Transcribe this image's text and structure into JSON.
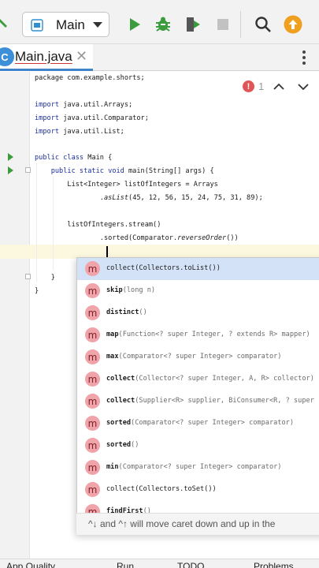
{
  "toolbar": {
    "run_config_label": "Main",
    "icons": [
      "hammer-icon",
      "java-class-icon",
      "run-icon",
      "debug-icon",
      "coverage-icon",
      "stop-icon",
      "search-icon",
      "update-icon"
    ],
    "colors": {
      "run": "#3c9b3c",
      "debug": "#3c9b3c",
      "update": "#f0a020"
    }
  },
  "tab": {
    "icon_letter": "C",
    "label": "Main.java",
    "close": "✕"
  },
  "inspection": {
    "count": "1"
  },
  "code": [
    {
      "parts": [
        {
          "t": "package com.example.shorts;",
          "c": ""
        }
      ]
    },
    {
      "parts": [
        {
          "t": "import",
          "c": "kw"
        },
        {
          "t": " java.util.Arrays;",
          "c": ""
        }
      ]
    },
    {
      "parts": [
        {
          "t": "import",
          "c": "kw"
        },
        {
          "t": " java.util.Comparator;",
          "c": ""
        }
      ]
    },
    {
      "parts": [
        {
          "t": "import",
          "c": "kw"
        },
        {
          "t": " java.util.List;",
          "c": ""
        }
      ]
    },
    {
      "parts": [
        {
          "t": "public class",
          "c": "kw"
        },
        {
          "t": " Main {",
          "c": ""
        }
      ]
    },
    {
      "parts": [
        {
          "t": "    public static void",
          "c": "kw"
        },
        {
          "t": " main(String[] args) {",
          "c": ""
        }
      ]
    },
    {
      "parts": [
        {
          "t": "        List<Integer> listOfIntegers = Arrays",
          "c": ""
        }
      ]
    },
    {
      "parts": [
        {
          "t": "                .",
          "c": ""
        },
        {
          "t": "asList",
          "c": "it"
        },
        {
          "t": "(45, 12, 56, 15, 24, 75, 31, 89);",
          "c": ""
        }
      ]
    },
    {
      "parts": [
        {
          "t": "        listOfIntegers.stream()",
          "c": ""
        }
      ]
    },
    {
      "parts": [
        {
          "t": "                .sorted(Comparator.",
          "c": ""
        },
        {
          "t": "reverseOrder",
          "c": "it"
        },
        {
          "t": "())",
          "c": ""
        }
      ]
    },
    {
      "parts": [
        {
          "t": "    }",
          "c": ""
        }
      ]
    },
    {
      "parts": [
        {
          "t": "}",
          "c": ""
        }
      ]
    }
  ],
  "completion": {
    "items": [
      {
        "name": "collect(Collectors.toList())",
        "params": "",
        "bold": false
      },
      {
        "name": "skip",
        "params": "(long n)",
        "bold": true
      },
      {
        "name": "distinct",
        "params": "()",
        "bold": true
      },
      {
        "name": "map",
        "params": "(Function<? super Integer, ? extends R> mapper)",
        "bold": true
      },
      {
        "name": "max",
        "params": "(Comparator<? super Integer> comparator)",
        "bold": true
      },
      {
        "name": "collect",
        "params": "(Collector<? super Integer, A, R> collector)",
        "bold": true
      },
      {
        "name": "collect",
        "params": "(Supplier<R> supplier, BiConsumer<R, ? super",
        "bold": true
      },
      {
        "name": "sorted",
        "params": "(Comparator<? super Integer> comparator)",
        "bold": true
      },
      {
        "name": "sorted",
        "params": "()",
        "bold": true
      },
      {
        "name": "min",
        "params": "(Comparator<? super Integer> comparator)",
        "bold": true
      },
      {
        "name": "collect(Collectors.toSet())",
        "params": "",
        "bold": false
      },
      {
        "name": "findFirst",
        "params": "()",
        "bold": true
      }
    ],
    "icon_letter": "m",
    "hint": "^↓ and ^↑ will move caret down and up in the"
  },
  "bottom_bar": [
    "App Quality...",
    "Run",
    "TODO",
    "Problems"
  ]
}
